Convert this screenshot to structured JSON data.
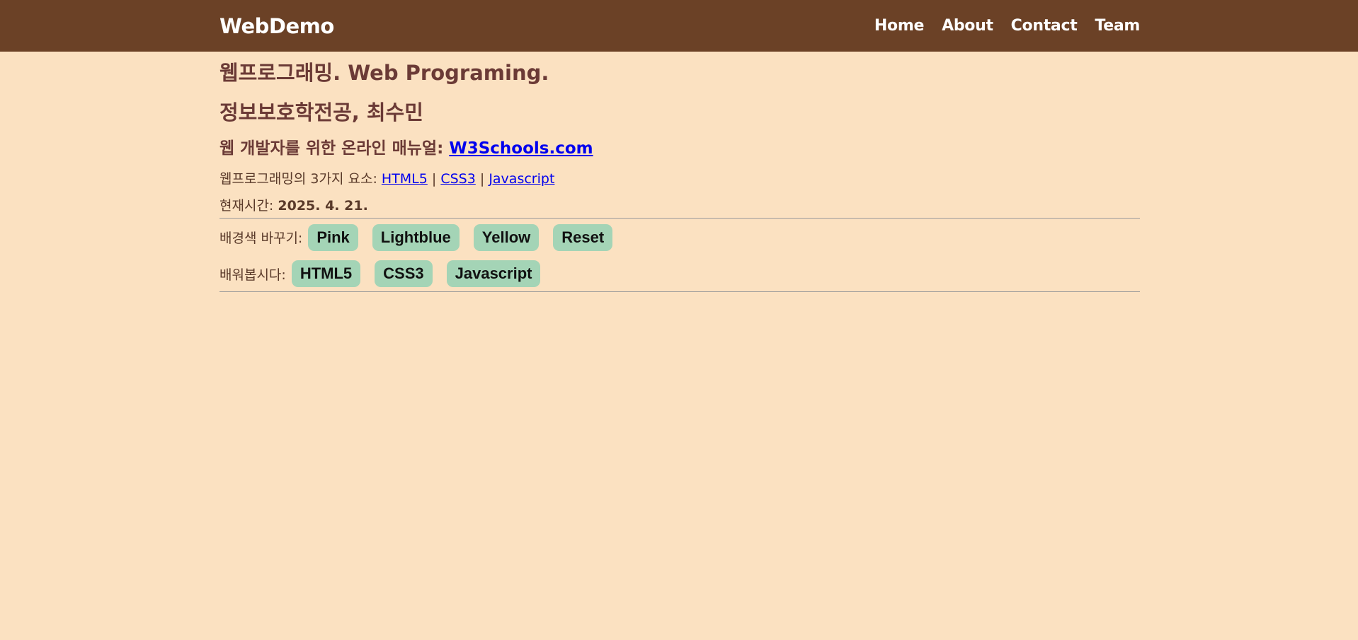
{
  "navbar": {
    "brand": "WebDemo",
    "links": [
      "Home",
      "About",
      "Contact",
      "Team"
    ]
  },
  "headings": {
    "title": "웹프로그래밍. Web Programing.",
    "subtitle": "정보보호학전공, 최수민",
    "manual_prefix": "웹 개발자를 위한 온라인 매뉴얼: ",
    "manual_link": "W3Schools.com"
  },
  "elements": {
    "prefix": "웹프로그래밍의 3가지 요소: ",
    "links": [
      "HTML5",
      "CSS3",
      "Javascript"
    ],
    "separator": " | "
  },
  "time": {
    "label": "현재시간: ",
    "value": "2025. 4. 21."
  },
  "bg_buttons": {
    "label": "배경색 바꾸기:",
    "buttons": [
      "Pink",
      "Lightblue",
      "Yellow",
      "Reset"
    ]
  },
  "learn_buttons": {
    "label": "배워봅시다:",
    "buttons": [
      "HTML5",
      "CSS3",
      "Javascript"
    ]
  },
  "colors": {
    "navbar_bg": "#6b4126",
    "page_bg": "#fbe1c1",
    "button_bg": "#a4d4b6",
    "heading": "#6b3a36",
    "link": "#0000ee"
  }
}
